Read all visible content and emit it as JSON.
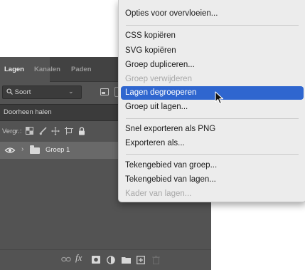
{
  "layers_panel": {
    "tabs": [
      "Lagen",
      "Kanalen",
      "Paden"
    ],
    "filter": {
      "label": "Soort"
    },
    "blend_mode": "Doorheen halen",
    "lock": {
      "label": "Vergr.:"
    },
    "layers": [
      {
        "name": "Groep 1",
        "visible": true,
        "type": "group"
      }
    ],
    "bottom_icons": [
      "link-icon",
      "fx-icon",
      "mask-icon",
      "adjustment-icon",
      "folder-icon",
      "new-layer-icon",
      "trash-icon"
    ]
  },
  "context_menu": {
    "items": [
      {
        "label": "Opties voor overvloeien...",
        "enabled": true
      },
      {
        "label": "CSS kopiëren",
        "enabled": true
      },
      {
        "label": "SVG kopiëren",
        "enabled": true
      },
      {
        "label": "Groep dupliceren...",
        "enabled": true
      },
      {
        "label": "Groep verwijderen",
        "enabled": false
      },
      {
        "label": "Lagen degroeperen",
        "enabled": true,
        "highlighted": true
      },
      {
        "label": "Groep uit lagen...",
        "enabled": true
      },
      {
        "label": "Snel exporteren als PNG",
        "enabled": true
      },
      {
        "label": "Exporteren als...",
        "enabled": true
      },
      {
        "label": "Tekengebied van groep...",
        "enabled": true
      },
      {
        "label": "Tekengebied van lagen...",
        "enabled": true
      },
      {
        "label": "Kader van lagen...",
        "enabled": false
      }
    ],
    "highlight_color": "#2f66cf"
  }
}
